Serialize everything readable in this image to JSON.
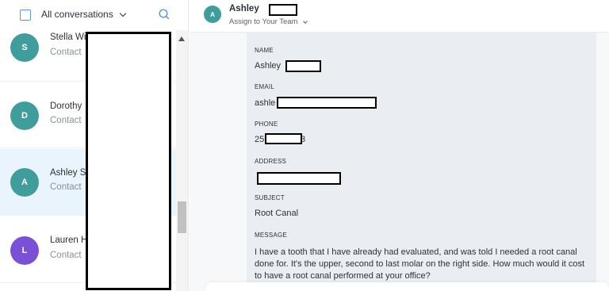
{
  "sidebar": {
    "filter_label": "All conversations",
    "conversations": [
      {
        "initial": "S",
        "name": "Stella Wi",
        "subtitle": "Contact",
        "color": "#3f9e9b",
        "selected": false
      },
      {
        "initial": "D",
        "name": "Dorothy",
        "subtitle": "Contact",
        "color": "#3f9e9b",
        "selected": false
      },
      {
        "initial": "A",
        "name": "Ashley S",
        "subtitle": "Contact",
        "color": "#3f9e9b",
        "selected": true
      },
      {
        "initial": "L",
        "name": "Lauren H",
        "subtitle": "Contact",
        "color": "#7b4fd6",
        "selected": false
      }
    ]
  },
  "header": {
    "initial": "A",
    "name": "Ashley",
    "assign_label": "Assign to Your Team"
  },
  "form": {
    "name_label": "NAME",
    "name_value": "Ashley",
    "email_label": "EMAIL",
    "email_value": "ashle",
    "phone_label": "PHONE",
    "phone_prefix": "25",
    "phone_suffix": "3",
    "address_label": "ADDRESS",
    "subject_label": "SUBJECT",
    "subject_value": "Root Canal",
    "message_label": "MESSAGE",
    "message_value": "I have a tooth that I have already had evaluated, and was told I needed a root canal done for. It's the upper, second to last molar on the right side. How much would it cost to have a root canal performed at your office?"
  },
  "colors": {
    "accent": "#5b8ff0",
    "teal_avatar": "#3f9e9b",
    "purple_avatar": "#7b4fd6",
    "selected_row": "#eaf4fd"
  }
}
